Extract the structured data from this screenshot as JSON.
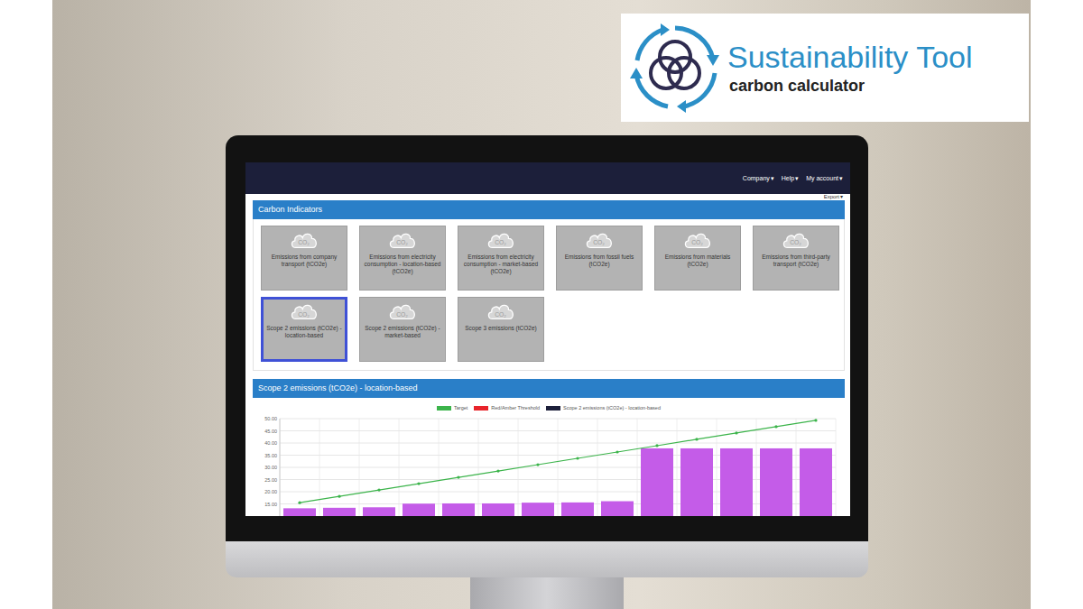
{
  "logo": {
    "title": "Sustainability Tool",
    "subtitle": "carbon calculator"
  },
  "navbar": {
    "menus": [
      {
        "label": "Company",
        "caret": "▾"
      },
      {
        "label": "Help",
        "caret": "▾"
      },
      {
        "label": "My account",
        "caret": "▾"
      }
    ]
  },
  "export": {
    "label": "Export",
    "caret": "▾"
  },
  "indicators_panel": {
    "title": "Carbon Indicators",
    "tile_icon_text": "CO₂",
    "tiles": [
      {
        "label": "Emissions from company transport (tCO2e)",
        "selected": false
      },
      {
        "label": "Emissions from electricity consumption - location-based (tCO2e)",
        "selected": false
      },
      {
        "label": "Emissions from electricity consumption - market-based (tCO2e)",
        "selected": false
      },
      {
        "label": "Emissions from fossil fuels (tCO2e)",
        "selected": false
      },
      {
        "label": "Emissions from materials (tCO2e)",
        "selected": false
      },
      {
        "label": "Emissions from third-party transport (tCO2e)",
        "selected": false
      },
      {
        "label": "Scope 2 emissions (tCO2e) - location-based",
        "selected": true
      },
      {
        "label": "Scope 2 emissions (tCO2e) - market-based",
        "selected": false
      },
      {
        "label": "Scope 3 emissions (tCO2e)",
        "selected": false
      }
    ]
  },
  "chart_panel": {
    "title": "Scope 2 emissions (tCO2e) - location-based",
    "legend": [
      {
        "label": "Target",
        "color": "#3cb44b"
      },
      {
        "label": "Red/Amber Threshold",
        "color": "#e8242b"
      },
      {
        "label": "Scope 2 emissions (tCO2e) - location-based",
        "color": "#1c1f3a"
      }
    ],
    "y_ticks": [
      "50.00",
      "45.00",
      "40.00",
      "35.00",
      "30.00",
      "25.00",
      "20.00",
      "15.00"
    ],
    "series": {
      "target": [
        15.5,
        18.1,
        20.7,
        23.3,
        25.9,
        28.5,
        31.1,
        33.7,
        36.3,
        38.9,
        41.5,
        44.1,
        46.7,
        49.3
      ],
      "emissions": [
        13.2,
        13.4,
        13.6,
        15.1,
        15.2,
        15.2,
        15.5,
        15.6,
        16.1,
        37.8,
        37.8,
        37.8,
        37.8,
        37.8
      ]
    }
  }
}
